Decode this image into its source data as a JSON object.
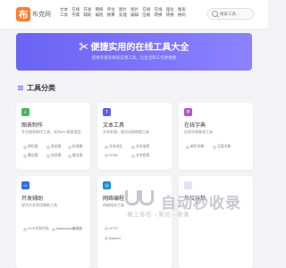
{
  "header": {
    "logo_glyph": "布",
    "logo_text": "布克网",
    "nav": [
      "文本工具",
      "在线字典",
      "开发辅助",
      "网络编程",
      "单位换算",
      "图片处理",
      "图片编辑",
      "在线压缩",
      "在线转换",
      "理化转换",
      "图表换码"
    ],
    "search_placeholder": "搜索工具..."
  },
  "hero": {
    "title": "✂ 便捷实用的在线工具大全",
    "subtitle": "提供丰富多样的实用工具，让生活和工作更便捷"
  },
  "section": {
    "title": "工具分类"
  },
  "cards": [
    {
      "title": "图表制作",
      "desc": "专业图表制作工具，支持20+图表类型",
      "icon": "chart-icon",
      "color": "#4bb35e",
      "glyph": "◐",
      "tags": [
        "饼状图",
        "条形图",
        "折线图",
        "雷达图",
        "柱状图",
        "散点图"
      ]
    },
    {
      "title": "文本工具",
      "desc": "文本处理、格式化和转换工具",
      "icon": "text-icon",
      "color": "#5b5bf0",
      "glyph": "T",
      "tags": [
        "文本对比",
        "文本加密",
        "HTML",
        "文字检测"
      ]
    },
    {
      "title": "在线字典",
      "desc": "在线字典查询工具",
      "icon": "dictionary-icon",
      "color": "#b04ed0",
      "glyph": "字",
      "tags": [
        "新华字典",
        "汉语字典"
      ]
    },
    {
      "title": "开发辅助",
      "desc": "程序开发常用辅助工具",
      "icon": "code-icon",
      "color": "#2f6ef0",
      "glyph": "</>",
      "tags": [
        "OCR识别代码",
        "Markdown编辑器"
      ]
    },
    {
      "title": "网络编程",
      "desc": "网络相关工具",
      "icon": "network-icon",
      "color": "#1a8fd1",
      "glyph": "◎",
      "tags": [
        "HTTP",
        "Base64"
      ]
    },
    {
      "title": "单位换算",
      "desc": "",
      "icon": "unit-icon",
      "color": "#e5e0f8",
      "glyph": "",
      "tags": []
    }
  ],
  "watermark": {
    "text": "自动秒收录",
    "sub": "做上排名→来访→收录"
  }
}
